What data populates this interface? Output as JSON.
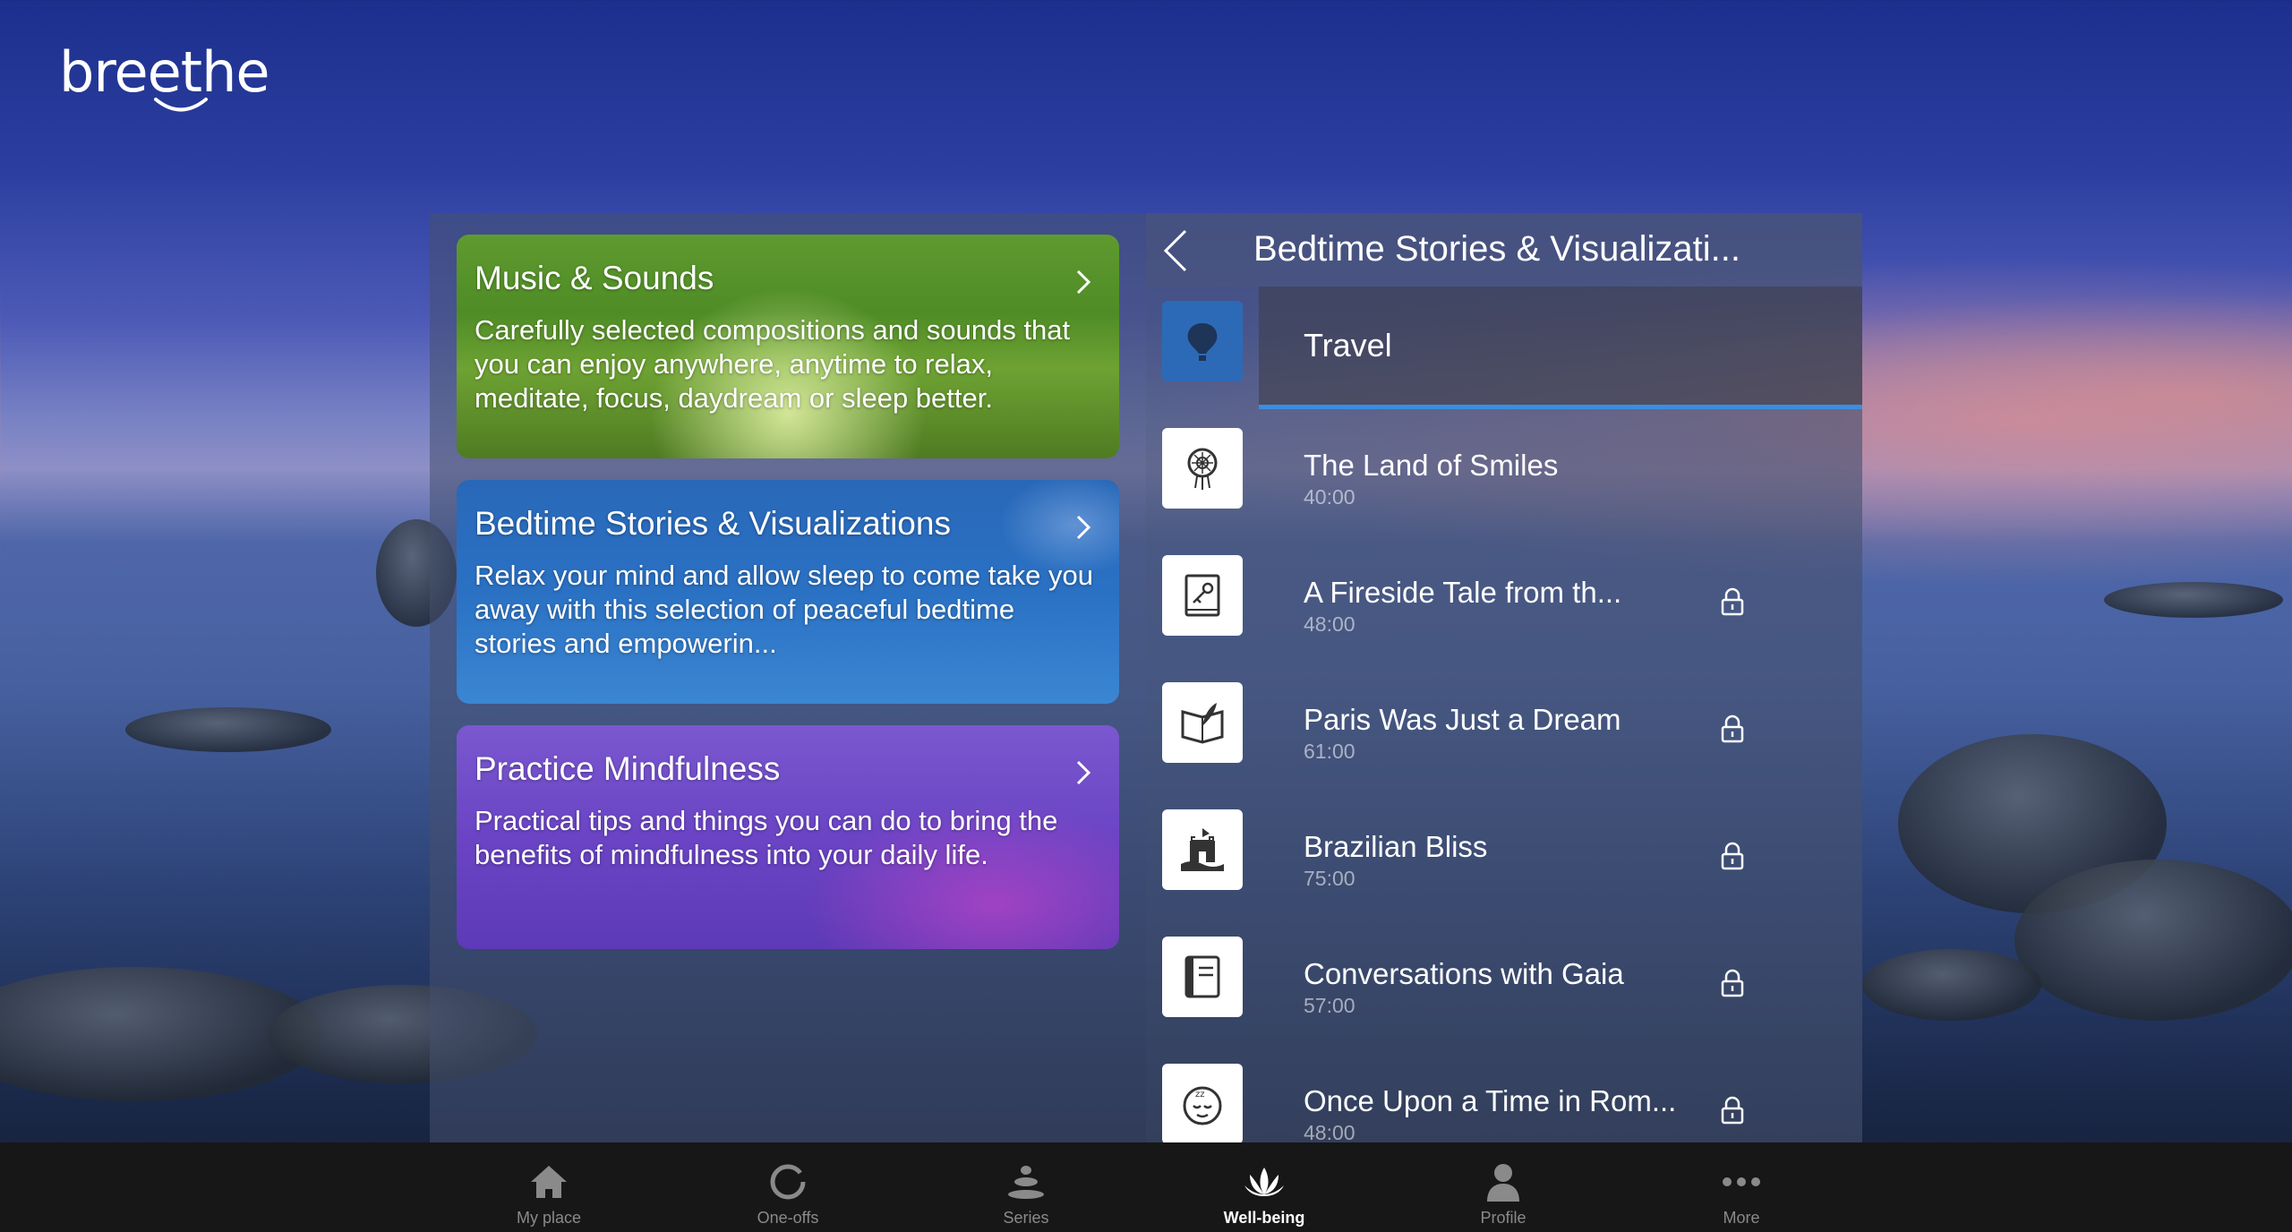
{
  "app": {
    "logo_text": "breethe"
  },
  "categories": [
    {
      "title": "Music & Sounds",
      "description": "Carefully selected compositions and sounds that you can enjoy anywhere, anytime to relax, meditate, focus, daydream or sleep better."
    },
    {
      "title": "Bedtime Stories & Visualizations",
      "description": "Relax your mind and allow sleep to come take you away with this selection of peaceful bedtime stories and empowerin..."
    },
    {
      "title": "Practice Mindfulness",
      "description": "Practical tips and things you can do to bring the benefits of mindfulness into your daily life."
    }
  ],
  "detail": {
    "title": "Bedtime Stories & Visualizati...",
    "section": {
      "title": "Travel",
      "icon": "hot-air-balloon-icon"
    },
    "items": [
      {
        "title": "The Land of Smiles",
        "duration": "40:00",
        "locked": false,
        "icon": "dreamcatcher-icon"
      },
      {
        "title": "A Fireside Tale from th...",
        "duration": "48:00",
        "locked": true,
        "icon": "book-key-icon"
      },
      {
        "title": "Paris Was Just a Dream",
        "duration": "61:00",
        "locked": true,
        "icon": "open-book-quill-icon"
      },
      {
        "title": "Brazilian Bliss",
        "duration": "75:00",
        "locked": true,
        "icon": "castle-icon"
      },
      {
        "title": "Conversations with Gaia",
        "duration": "57:00",
        "locked": true,
        "icon": "notebook-icon"
      },
      {
        "title": "Once Upon a Time in Rom...",
        "duration": "48:00",
        "locked": true,
        "icon": "sleeping-face-icon"
      }
    ]
  },
  "nav": [
    {
      "label": "My place",
      "icon": "home-icon",
      "active": false
    },
    {
      "label": "One-offs",
      "icon": "circle-icon",
      "active": false
    },
    {
      "label": "Series",
      "icon": "stacked-stones-icon",
      "active": false
    },
    {
      "label": "Well-being",
      "icon": "lotus-icon",
      "active": true
    },
    {
      "label": "Profile",
      "icon": "person-icon",
      "active": false
    },
    {
      "label": "More",
      "icon": "more-dots-icon",
      "active": false
    }
  ],
  "colors": {
    "accent": "#3a8ee0",
    "music_card": "#5f9a2f",
    "bedtime_card": "#2a71c4",
    "mindfulness_card": "#6a44c4",
    "nav_bg": "#171717"
  }
}
